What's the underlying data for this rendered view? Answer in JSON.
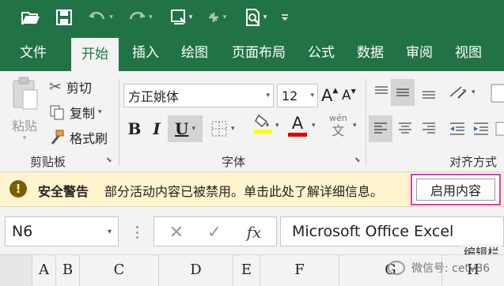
{
  "quick_access": {
    "icons": [
      "open-folder-icon",
      "save-icon",
      "undo-icon",
      "redo-icon",
      "form-icon",
      "pin-icon",
      "print-preview-icon",
      "customize-icon"
    ]
  },
  "tabs": [
    "文件",
    "开始",
    "插入",
    "绘图",
    "页面布局",
    "公式",
    "数据",
    "审阅",
    "视图"
  ],
  "active_tab": "开始",
  "clipboard": {
    "paste": "粘贴",
    "cut": "剪切",
    "copy": "复制",
    "format_painter": "格式刷",
    "label": "剪贴板"
  },
  "font": {
    "name": "方正姚体",
    "size": "12",
    "grow": "A",
    "shrink": "A",
    "bold": "B",
    "italic": "I",
    "underline": "U",
    "color_letter": "A",
    "wen": "wén",
    "wen_char": "文",
    "label": "字体",
    "highlight_color": "#ffff00",
    "font_color": "#e00000"
  },
  "alignment": {
    "label": "对齐方式"
  },
  "security": {
    "icon": "!",
    "title": "安全警告",
    "message": "部分活动内容已被禁用。单击此处了解详细信息。",
    "button": "启用内容"
  },
  "formula_bar": {
    "name_box": "N6",
    "cancel": "✕",
    "enter": "✓",
    "fx": "fx",
    "value": "Microsoft Office Excel",
    "tip": "编辑栏"
  },
  "columns": [
    "A",
    "B",
    "C",
    "D",
    "E",
    "F",
    "G",
    "H"
  ],
  "watermark": "微信号: cetv86",
  "colors": {
    "excel_green": "#217346",
    "ribbon_bg": "#f3f3f3",
    "security_bg": "#fff4ce",
    "enable_outline": "#d63ad0"
  }
}
